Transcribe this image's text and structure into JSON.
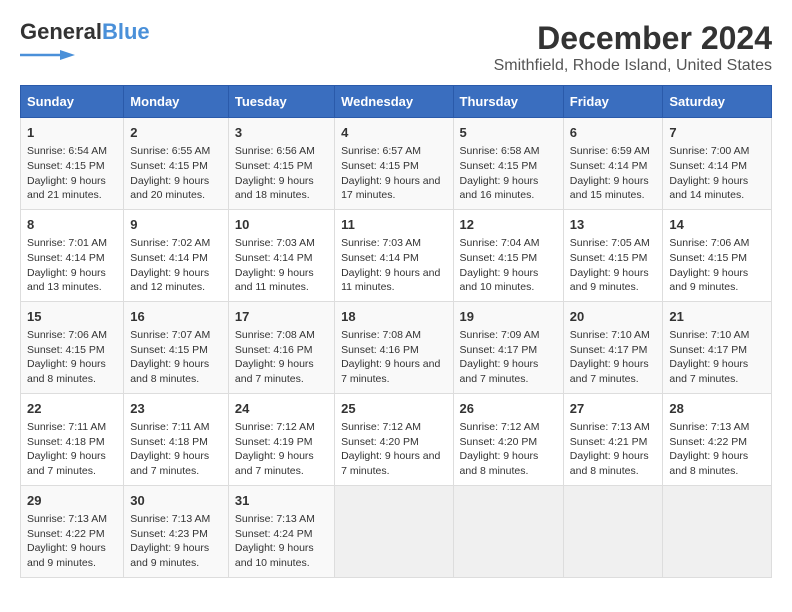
{
  "header": {
    "logo_general": "General",
    "logo_blue": "Blue",
    "title": "December 2024",
    "subtitle": "Smithfield, Rhode Island, United States"
  },
  "columns": [
    "Sunday",
    "Monday",
    "Tuesday",
    "Wednesday",
    "Thursday",
    "Friday",
    "Saturday"
  ],
  "weeks": [
    [
      {
        "day": "1",
        "sunrise": "Sunrise: 6:54 AM",
        "sunset": "Sunset: 4:15 PM",
        "daylight": "Daylight: 9 hours and 21 minutes."
      },
      {
        "day": "2",
        "sunrise": "Sunrise: 6:55 AM",
        "sunset": "Sunset: 4:15 PM",
        "daylight": "Daylight: 9 hours and 20 minutes."
      },
      {
        "day": "3",
        "sunrise": "Sunrise: 6:56 AM",
        "sunset": "Sunset: 4:15 PM",
        "daylight": "Daylight: 9 hours and 18 minutes."
      },
      {
        "day": "4",
        "sunrise": "Sunrise: 6:57 AM",
        "sunset": "Sunset: 4:15 PM",
        "daylight": "Daylight: 9 hours and 17 minutes."
      },
      {
        "day": "5",
        "sunrise": "Sunrise: 6:58 AM",
        "sunset": "Sunset: 4:15 PM",
        "daylight": "Daylight: 9 hours and 16 minutes."
      },
      {
        "day": "6",
        "sunrise": "Sunrise: 6:59 AM",
        "sunset": "Sunset: 4:14 PM",
        "daylight": "Daylight: 9 hours and 15 minutes."
      },
      {
        "day": "7",
        "sunrise": "Sunrise: 7:00 AM",
        "sunset": "Sunset: 4:14 PM",
        "daylight": "Daylight: 9 hours and 14 minutes."
      }
    ],
    [
      {
        "day": "8",
        "sunrise": "Sunrise: 7:01 AM",
        "sunset": "Sunset: 4:14 PM",
        "daylight": "Daylight: 9 hours and 13 minutes."
      },
      {
        "day": "9",
        "sunrise": "Sunrise: 7:02 AM",
        "sunset": "Sunset: 4:14 PM",
        "daylight": "Daylight: 9 hours and 12 minutes."
      },
      {
        "day": "10",
        "sunrise": "Sunrise: 7:03 AM",
        "sunset": "Sunset: 4:14 PM",
        "daylight": "Daylight: 9 hours and 11 minutes."
      },
      {
        "day": "11",
        "sunrise": "Sunrise: 7:03 AM",
        "sunset": "Sunset: 4:14 PM",
        "daylight": "Daylight: 9 hours and 11 minutes."
      },
      {
        "day": "12",
        "sunrise": "Sunrise: 7:04 AM",
        "sunset": "Sunset: 4:15 PM",
        "daylight": "Daylight: 9 hours and 10 minutes."
      },
      {
        "day": "13",
        "sunrise": "Sunrise: 7:05 AM",
        "sunset": "Sunset: 4:15 PM",
        "daylight": "Daylight: 9 hours and 9 minutes."
      },
      {
        "day": "14",
        "sunrise": "Sunrise: 7:06 AM",
        "sunset": "Sunset: 4:15 PM",
        "daylight": "Daylight: 9 hours and 9 minutes."
      }
    ],
    [
      {
        "day": "15",
        "sunrise": "Sunrise: 7:06 AM",
        "sunset": "Sunset: 4:15 PM",
        "daylight": "Daylight: 9 hours and 8 minutes."
      },
      {
        "day": "16",
        "sunrise": "Sunrise: 7:07 AM",
        "sunset": "Sunset: 4:15 PM",
        "daylight": "Daylight: 9 hours and 8 minutes."
      },
      {
        "day": "17",
        "sunrise": "Sunrise: 7:08 AM",
        "sunset": "Sunset: 4:16 PM",
        "daylight": "Daylight: 9 hours and 7 minutes."
      },
      {
        "day": "18",
        "sunrise": "Sunrise: 7:08 AM",
        "sunset": "Sunset: 4:16 PM",
        "daylight": "Daylight: 9 hours and 7 minutes."
      },
      {
        "day": "19",
        "sunrise": "Sunrise: 7:09 AM",
        "sunset": "Sunset: 4:17 PM",
        "daylight": "Daylight: 9 hours and 7 minutes."
      },
      {
        "day": "20",
        "sunrise": "Sunrise: 7:10 AM",
        "sunset": "Sunset: 4:17 PM",
        "daylight": "Daylight: 9 hours and 7 minutes."
      },
      {
        "day": "21",
        "sunrise": "Sunrise: 7:10 AM",
        "sunset": "Sunset: 4:17 PM",
        "daylight": "Daylight: 9 hours and 7 minutes."
      }
    ],
    [
      {
        "day": "22",
        "sunrise": "Sunrise: 7:11 AM",
        "sunset": "Sunset: 4:18 PM",
        "daylight": "Daylight: 9 hours and 7 minutes."
      },
      {
        "day": "23",
        "sunrise": "Sunrise: 7:11 AM",
        "sunset": "Sunset: 4:18 PM",
        "daylight": "Daylight: 9 hours and 7 minutes."
      },
      {
        "day": "24",
        "sunrise": "Sunrise: 7:12 AM",
        "sunset": "Sunset: 4:19 PM",
        "daylight": "Daylight: 9 hours and 7 minutes."
      },
      {
        "day": "25",
        "sunrise": "Sunrise: 7:12 AM",
        "sunset": "Sunset: 4:20 PM",
        "daylight": "Daylight: 9 hours and 7 minutes."
      },
      {
        "day": "26",
        "sunrise": "Sunrise: 7:12 AM",
        "sunset": "Sunset: 4:20 PM",
        "daylight": "Daylight: 9 hours and 8 minutes."
      },
      {
        "day": "27",
        "sunrise": "Sunrise: 7:13 AM",
        "sunset": "Sunset: 4:21 PM",
        "daylight": "Daylight: 9 hours and 8 minutes."
      },
      {
        "day": "28",
        "sunrise": "Sunrise: 7:13 AM",
        "sunset": "Sunset: 4:22 PM",
        "daylight": "Daylight: 9 hours and 8 minutes."
      }
    ],
    [
      {
        "day": "29",
        "sunrise": "Sunrise: 7:13 AM",
        "sunset": "Sunset: 4:22 PM",
        "daylight": "Daylight: 9 hours and 9 minutes."
      },
      {
        "day": "30",
        "sunrise": "Sunrise: 7:13 AM",
        "sunset": "Sunset: 4:23 PM",
        "daylight": "Daylight: 9 hours and 9 minutes."
      },
      {
        "day": "31",
        "sunrise": "Sunrise: 7:13 AM",
        "sunset": "Sunset: 4:24 PM",
        "daylight": "Daylight: 9 hours and 10 minutes."
      },
      null,
      null,
      null,
      null
    ]
  ]
}
